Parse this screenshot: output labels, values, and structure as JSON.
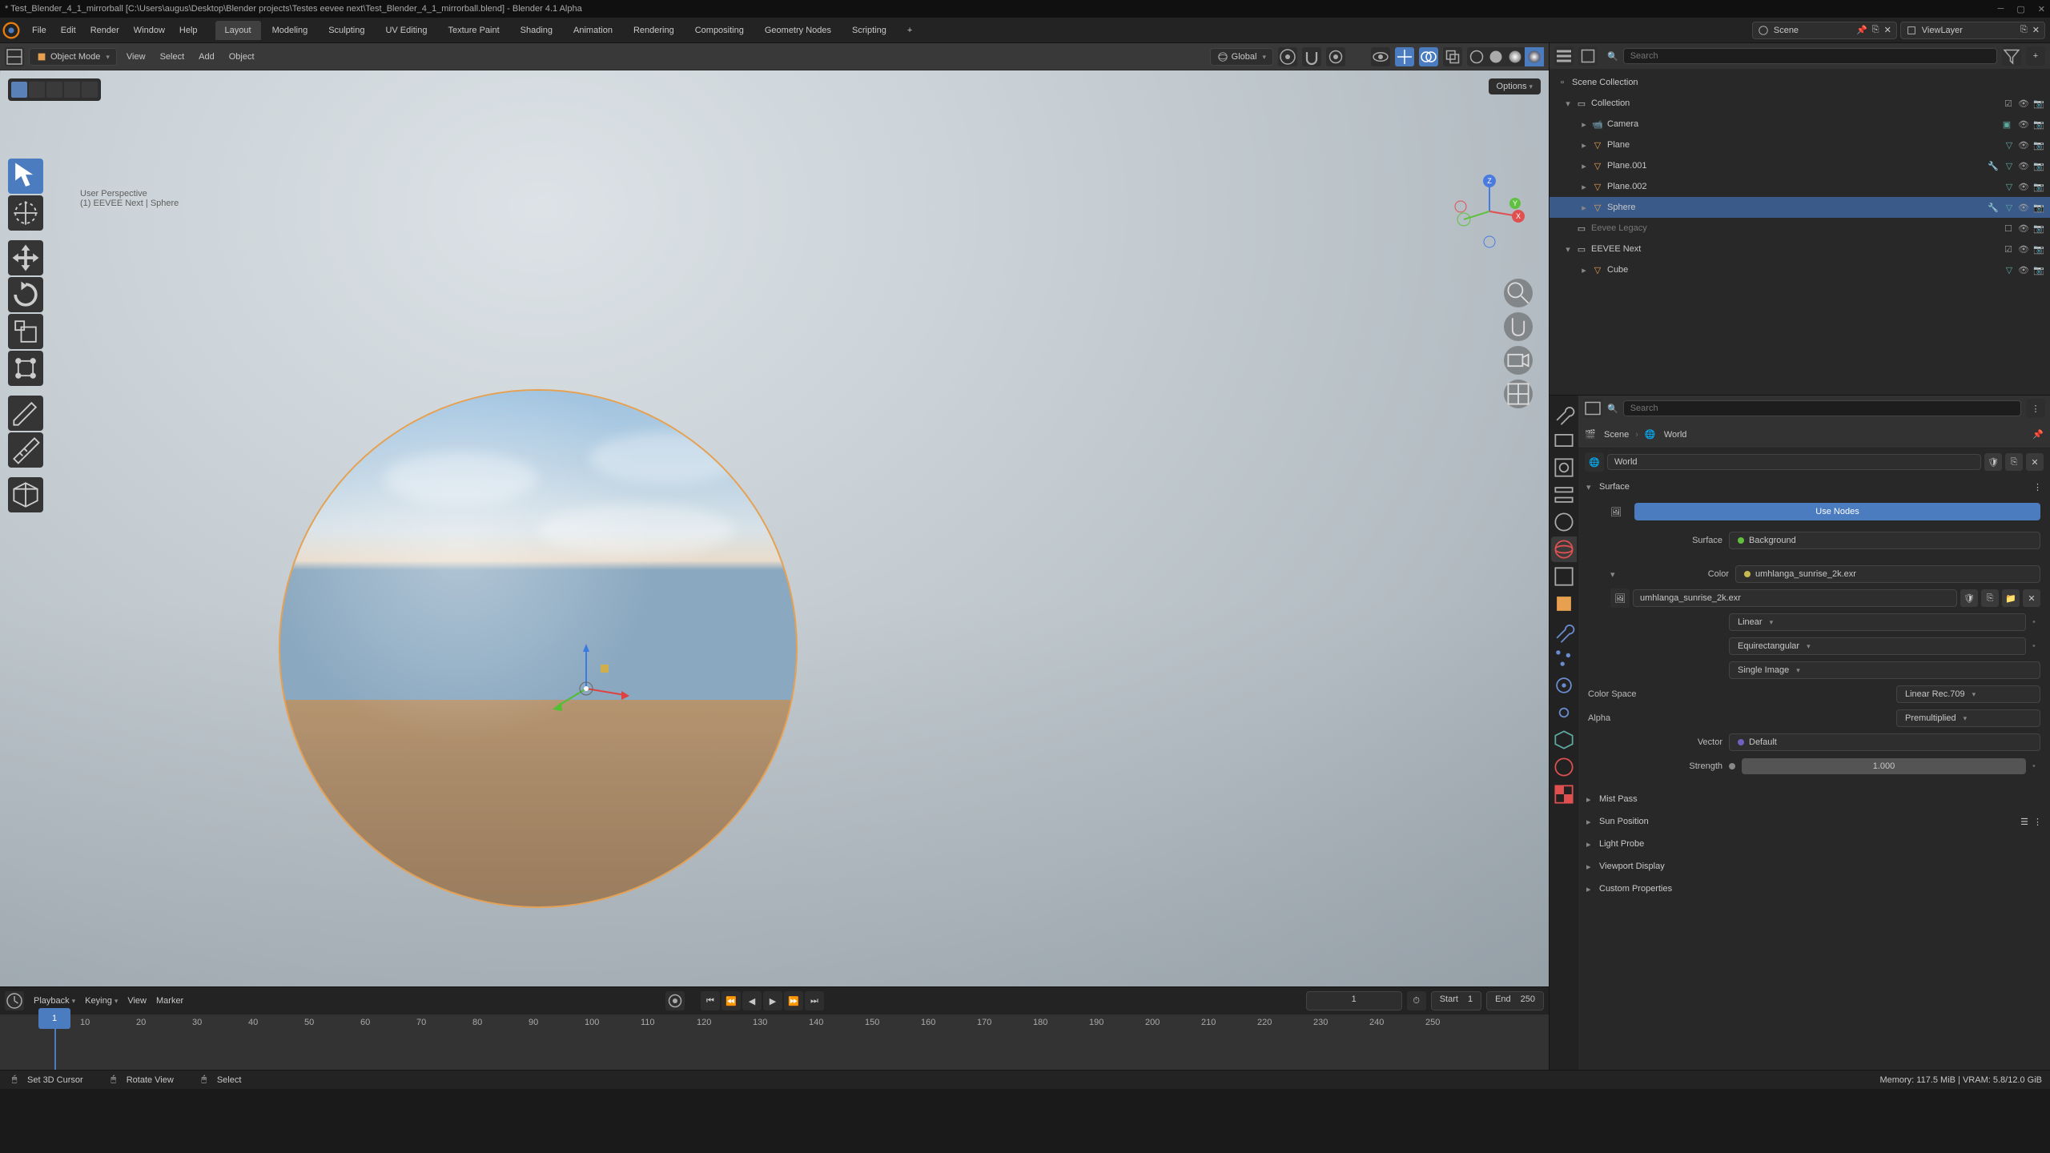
{
  "titlebar": {
    "text": "* Test_Blender_4_1_mirrorball [C:\\Users\\augus\\Desktop\\Blender projects\\Testes eevee next\\Test_Blender_4_1_mirrorball.blend] - Blender 4.1 Alpha"
  },
  "menu": {
    "file": "File",
    "edit": "Edit",
    "render": "Render",
    "window": "Window",
    "help": "Help"
  },
  "workspaces": [
    "Layout",
    "Modeling",
    "Sculpting",
    "UV Editing",
    "Texture Paint",
    "Shading",
    "Animation",
    "Rendering",
    "Compositing",
    "Geometry Nodes",
    "Scripting"
  ],
  "topright": {
    "scene": "Scene",
    "viewlayer": "ViewLayer"
  },
  "view3d_header": {
    "mode": "Object Mode",
    "menus": {
      "view": "View",
      "select": "Select",
      "add": "Add",
      "object": "Object"
    },
    "orientation": "Global"
  },
  "viewport": {
    "perspective": "User Perspective",
    "info": "(1) EEVEE Next | Sphere",
    "options": "Options"
  },
  "outliner": {
    "search_placeholder": "Search",
    "scene_collection": "Scene Collection",
    "collection": "Collection",
    "items": {
      "camera": "Camera",
      "plane": "Plane",
      "plane001": "Plane.001",
      "plane002": "Plane.002",
      "sphere": "Sphere",
      "eevee_legacy": "Eevee Legacy",
      "eevee_next": "EEVEE Next",
      "cube": "Cube"
    }
  },
  "properties": {
    "search_placeholder": "Search",
    "breadcrumb": {
      "scene": "Scene",
      "world": "World"
    },
    "world_id": "World",
    "surface_panel": "Surface",
    "use_nodes": "Use Nodes",
    "rows": {
      "surface_label": "Surface",
      "surface_val": "Background",
      "color_label": "Color",
      "color_val": "umhlanga_sunrise_2k.exr",
      "texture_name": "umhlanga_sunrise_2k.exr",
      "interpolation": "Linear",
      "projection": "Equirectangular",
      "image_source": "Single Image",
      "colorspace_label": "Color Space",
      "colorspace_val": "Linear Rec.709",
      "alpha_label": "Alpha",
      "alpha_val": "Premultiplied",
      "vector_label": "Vector",
      "vector_val": "Default",
      "strength_label": "Strength",
      "strength_val": "1.000"
    },
    "collapsed": {
      "mist": "Mist Pass",
      "sun": "Sun Position",
      "probe": "Light Probe",
      "viewport": "Viewport Display",
      "custom": "Custom Properties"
    }
  },
  "timeline": {
    "playback": "Playback",
    "keying": "Keying",
    "view": "View",
    "marker": "Marker",
    "current_frame": "1",
    "start_label": "Start",
    "start": "1",
    "end_label": "End",
    "end": "250",
    "ticks": [
      "10",
      "20",
      "30",
      "40",
      "50",
      "60",
      "70",
      "80",
      "90",
      "100",
      "110",
      "120",
      "130",
      "140",
      "150",
      "160",
      "170",
      "180",
      "190",
      "200",
      "210",
      "220",
      "230",
      "240",
      "250"
    ]
  },
  "statusbar": {
    "cursor": "Set 3D Cursor",
    "rotate": "Rotate View",
    "select": "Select",
    "memory": "Memory: 117.5 MiB | VRAM: 5.8/12.0 GiB"
  }
}
